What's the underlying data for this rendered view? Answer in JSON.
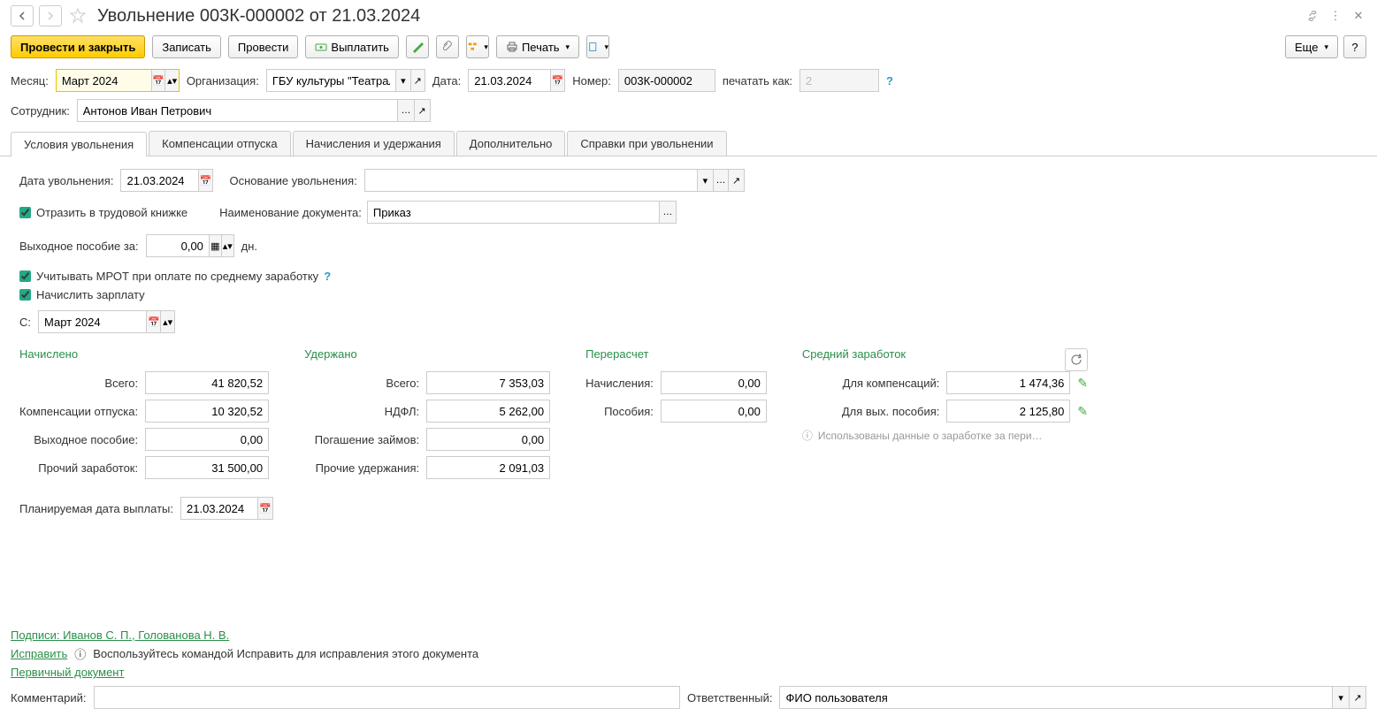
{
  "header": {
    "title": "Увольнение 003К-000002 от 21.03.2024"
  },
  "toolbar": {
    "post_and_close": "Провести и закрыть",
    "save": "Записать",
    "post": "Провести",
    "pay": "Выплатить",
    "print": "Печать",
    "more": "Еще"
  },
  "fields": {
    "month_label": "Месяц:",
    "month_value": "Март 2024",
    "org_label": "Организация:",
    "org_value": "ГБУ культуры \"Театральн",
    "date_label": "Дата:",
    "date_value": "21.03.2024",
    "number_label": "Номер:",
    "number_value": "003К-000002",
    "print_as_label": "печатать как:",
    "print_as_value": "2",
    "employee_label": "Сотрудник:",
    "employee_value": "Антонов Иван Петрович"
  },
  "tabs": {
    "t1": "Условия увольнения",
    "t2": "Компенсации отпуска",
    "t3": "Начисления и удержания",
    "t4": "Дополнительно",
    "t5": "Справки при увольнении"
  },
  "tab1": {
    "dismissal_date_label": "Дата увольнения:",
    "dismissal_date_value": "21.03.2024",
    "reason_label": "Основание увольнения:",
    "reason_value": "",
    "reflect_label": "Отразить в трудовой книжке",
    "doc_name_label": "Наименование документа:",
    "doc_name_value": "Приказ",
    "severance_label": "Выходное пособие за:",
    "severance_value": "0,00",
    "severance_unit": "дн.",
    "mrot_label": "Учитывать МРОТ при оплате по среднему заработку",
    "accrue_label": "Начислить зарплату",
    "from_label": "С:",
    "from_value": "Март 2024",
    "planned_date_label": "Планируемая дата выплаты:",
    "planned_date_value": "21.03.2024"
  },
  "summary": {
    "accrued_header": "Начислено",
    "withheld_header": "Удержано",
    "recalc_header": "Перерасчет",
    "avg_header": "Средний заработок",
    "total_label": "Всего:",
    "accrued_total": "41 820,52",
    "vacation_comp_label": "Компенсации отпуска:",
    "vacation_comp": "10 320,52",
    "severance_pay_label": "Выходное пособие:",
    "severance_pay": "0,00",
    "other_income_label": "Прочий заработок:",
    "other_income": "31 500,00",
    "withheld_total": "7 353,03",
    "ndfl_label": "НДФЛ:",
    "ndfl": "5 262,00",
    "loan_label": "Погашение займов:",
    "loan": "0,00",
    "other_withheld_label": "Прочие удержания:",
    "other_withheld": "2 091,03",
    "accruals_label": "Начисления:",
    "accruals": "0,00",
    "benefits_label": "Пособия:",
    "benefits": "0,00",
    "for_comp_label": "Для компенсаций:",
    "for_comp": "1 474,36",
    "for_sev_label": "Для вых. пособия:",
    "for_sev": "2 125,80",
    "info_text": "Использованы данные о заработке за пери…"
  },
  "footer": {
    "signatures": "Подписи: Иванов С. П., Голованова Н. В.",
    "fix_link": "Исправить",
    "fix_text": "Воспользуйтесь командой Исправить для исправления этого документа",
    "primary_doc": "Первичный документ",
    "comment_label": "Комментарий:",
    "comment_value": "",
    "responsible_label": "Ответственный:",
    "responsible_value": "ФИО пользователя"
  }
}
